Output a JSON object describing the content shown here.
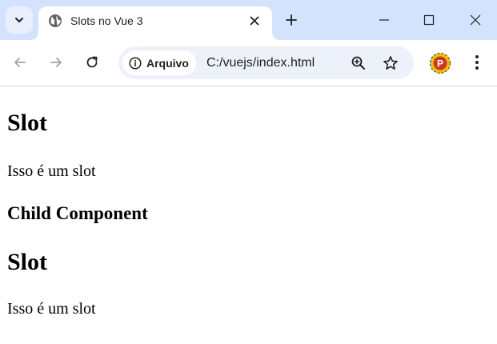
{
  "browser": {
    "tab": {
      "title": "Slots no Vue 3"
    },
    "omnibox": {
      "security_chip": "Arquivo",
      "url": "C:/vuejs/index.html"
    },
    "profile": {
      "initial": "P"
    },
    "icons": {
      "tab_search": "chevron-down-icon",
      "favicon": "globe-icon",
      "close": "close-icon",
      "new_tab": "plus-icon",
      "minimize": "minimize-icon",
      "maximize": "maximize-icon",
      "window_close": "close-icon",
      "back": "arrow-left-icon",
      "forward": "arrow-right-icon",
      "reload": "reload-icon",
      "info": "info-icon",
      "zoom": "zoom-in-icon",
      "bookmark": "star-icon",
      "menu": "kebab-menu-icon"
    },
    "colors": {
      "tabbar": "#d3e3fd",
      "omnibox": "#edf2fa",
      "profile_ring": "#e8c400",
      "profile_fill": "#d93025"
    }
  },
  "page": {
    "heading_1": "Slot",
    "slot_text_1": "Isso é um slot",
    "child_heading": "Child Component",
    "heading_2": "Slot",
    "slot_text_2": "Isso é um slot"
  }
}
